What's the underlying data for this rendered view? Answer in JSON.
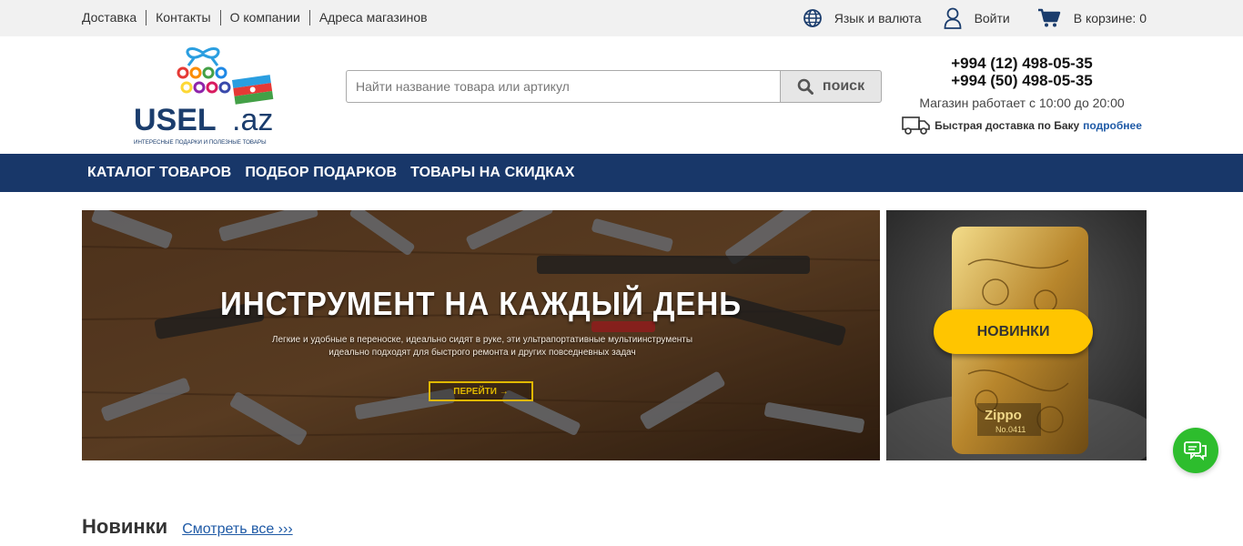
{
  "topbar": {
    "links": [
      "Доставка",
      "Контакты",
      "О компании",
      "Адреса магазинов"
    ],
    "lang_label": "Язык и валюта",
    "login_label": "Войти",
    "cart_label": "В корзине: 0"
  },
  "logo": {
    "brand_main": "USEL",
    "brand_suffix": ".az",
    "tagline": "ИНТЕРЕСНЫЕ ПОДАРКИ И ПОЛЕЗНЫЕ ТОВАРЫ"
  },
  "search": {
    "placeholder": "Найти название товара или артикул",
    "value": "",
    "button_label": "поиск"
  },
  "contacts": {
    "phone1": "+994 (12) 498-05-35",
    "phone2": "+994 (50) 498-05-35",
    "hours": "Магазин работает с 10:00 до 20:00",
    "delivery_text": "Быстрая доставка по Баку",
    "delivery_link": "подробнее"
  },
  "nav": {
    "items": [
      "КАТАЛОГ ТОВАРОВ",
      "ПОДБОР ПОДАРКОВ",
      "ТОВАРЫ НА СКИДКАХ"
    ]
  },
  "banner_main": {
    "title": "ИНСТРУМЕНТ НА КАЖДЫЙ ДЕНЬ",
    "subtitle": "Легкие и удобные в переноске, идеально сидят в руке, эти ультрапортативные мультиинструменты идеально подходят для быстрого ремонта и других повседневных задач",
    "button_label": "ПЕРЕЙТИ →"
  },
  "banner_side": {
    "button_label": "НОВИНКИ",
    "lighter_brand": "Zippo",
    "lighter_number": "No.0411"
  },
  "section": {
    "title": "Новинки",
    "see_all": "Смотреть все ›››"
  },
  "colors": {
    "nav_bg": "#183769",
    "accent_yellow": "#ffc500",
    "chat_green": "#2dbd2d",
    "link_blue": "#1f5aa6"
  }
}
